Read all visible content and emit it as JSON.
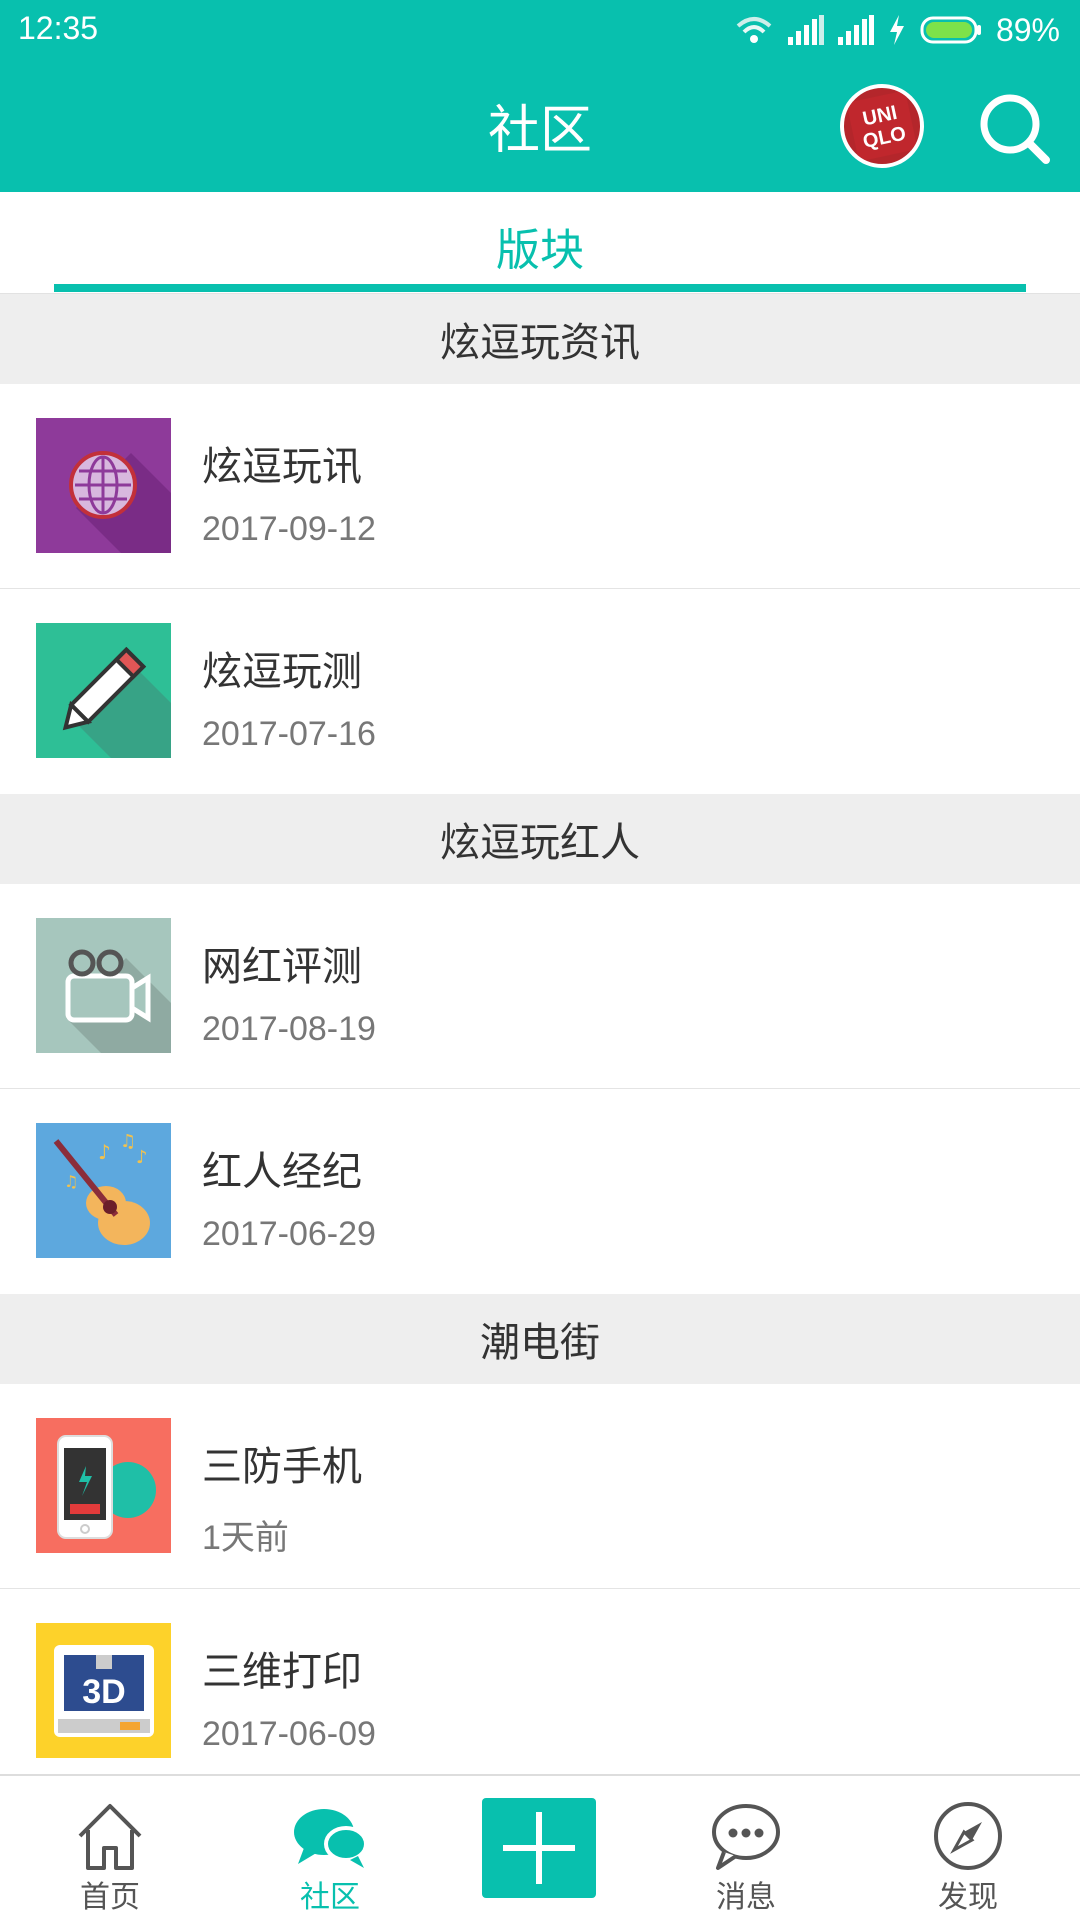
{
  "status_bar": {
    "time": "12:35",
    "battery": "89%"
  },
  "header": {
    "title": "社区"
  },
  "tabs": {
    "active": "版块"
  },
  "sections": [
    {
      "name": "炫逗玩资讯",
      "items": [
        {
          "title": "炫逗玩讯",
          "date": "2017-09-12",
          "icon": "globe-icon",
          "color": "#8e3a9a"
        },
        {
          "title": "炫逗玩测",
          "date": "2017-07-16",
          "icon": "pencil-icon",
          "color": "#2ebf96"
        }
      ]
    },
    {
      "name": "炫逗玩红人",
      "items": [
        {
          "title": "网红评测",
          "date": "2017-08-19",
          "icon": "video-camera-icon",
          "color": "#a6c6bd"
        },
        {
          "title": "红人经纪",
          "date": "2017-06-29",
          "icon": "guitar-icon",
          "color": "#5da8de"
        }
      ]
    },
    {
      "name": "潮电街",
      "items": [
        {
          "title": "三防手机",
          "date": "1天前",
          "icon": "phone-battery-icon",
          "color": "#f76e60"
        },
        {
          "title": "三维打印",
          "date": "2017-06-09",
          "icon": "3d-printer-icon",
          "color": "#fdd22a"
        }
      ]
    }
  ],
  "bottom_nav": {
    "home": "首页",
    "community": "社区",
    "messages": "消息",
    "discover": "发现"
  },
  "avatar_text": "UNIQLO",
  "colors": {
    "accent": "#08c0ae",
    "section_bg": "#eeeeee"
  }
}
